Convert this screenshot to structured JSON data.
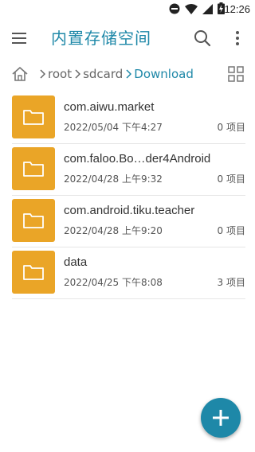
{
  "status_bar": {
    "time": "12:26",
    "icons": [
      "do-not-disturb-icon",
      "wifi-icon",
      "signal-icon",
      "battery-charging-icon"
    ]
  },
  "app_bar": {
    "title": "内置存储空间",
    "icons": [
      "menu-icon",
      "search-icon",
      "more-vert-icon"
    ]
  },
  "breadcrumb": {
    "home_icon": "home-icon",
    "items": [
      {
        "label": "root"
      },
      {
        "label": "sdcard"
      },
      {
        "label": "Download"
      }
    ],
    "view_icon": "grid-view-icon"
  },
  "files": [
    {
      "name": "com.aiwu.market",
      "date": "2022/05/04 下午4:27",
      "count": "0 项目"
    },
    {
      "name": "com.faloo.Bo…der4Android",
      "date": "2022/04/28 上午9:32",
      "count": "0 项目"
    },
    {
      "name": "com.android.tiku.teacher",
      "date": "2022/04/28 上午9:20",
      "count": "0 项目"
    },
    {
      "name": "data",
      "date": "2022/04/25 下午8:08",
      "count": "3 项目"
    }
  ],
  "fab": {
    "icon": "add-icon"
  },
  "colors": {
    "accent": "#1e88a8",
    "folder": "#eaa527",
    "divider": "#e6e6e6"
  }
}
